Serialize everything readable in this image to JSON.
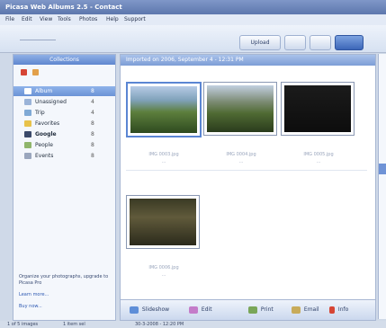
{
  "window": {
    "title": "Picasa Web Albums 2.5 - Contact"
  },
  "menu": [
    "File",
    "Edit",
    "View",
    "Tools",
    "Photos",
    "Help",
    "Support"
  ],
  "toolbar": {
    "buttons": [
      {
        "label": "Upload"
      },
      {
        "label": ""
      },
      {
        "label": ""
      },
      {
        "label": ""
      }
    ]
  },
  "sidebar": {
    "header": "Collections",
    "items": [
      {
        "label": "Album",
        "count": "8"
      },
      {
        "label": "Unassigned",
        "count": "4"
      },
      {
        "label": "Trip",
        "count": "4"
      },
      {
        "label": "Favorites",
        "count": "8"
      },
      {
        "label": "Google",
        "count": "8"
      },
      {
        "label": "People",
        "count": "8"
      },
      {
        "label": "Events",
        "count": "8"
      }
    ],
    "promo": {
      "text": "Organize your photographs, upgrade to Picasa Pro",
      "link1": "Learn more...",
      "link2": "Buy now..."
    }
  },
  "main": {
    "header": "Imported on 2006, September 4 - 12:31 PM",
    "photos": [
      {
        "caption": "IMG 0003.jpg",
        "sub": "...",
        "selected": true,
        "gradient": "linear-gradient(#b7cbe6 0%, #7fa1b9 30%, #5d7f3d 55%, #2e4a1f 100%)"
      },
      {
        "caption": "IMG 0004.jpg",
        "sub": "...",
        "selected": false,
        "gradient": "linear-gradient(#c2cfe0 0%, #7c8b74 35%, #4f6a33 60%, #2a3b1c 100%)"
      },
      {
        "caption": "IMG 0005.jpg",
        "sub": "...",
        "selected": false,
        "gradient": "linear-gradient(#1b1b1b, #0d0d0d)"
      },
      {
        "caption": "IMG 0006.jpg",
        "sub": "...",
        "selected": false,
        "gradient": "linear-gradient(#3a3a24 0%, #605a3b 40%, #2b2a1c 100%)"
      }
    ]
  },
  "bottom": {
    "buttons": [
      {
        "label": "Slideshow"
      },
      {
        "label": "Edit"
      },
      {
        "label": "Print"
      },
      {
        "label": "Email"
      },
      {
        "label": "Info"
      }
    ]
  },
  "status": {
    "left": "1 of 5 images",
    "mid": "1 item sel",
    "right": "30-3-2008 - 12:20 PM"
  },
  "colors": {
    "accent": "#5f86cf",
    "selection": "#6b93d6"
  }
}
